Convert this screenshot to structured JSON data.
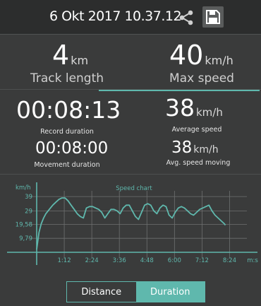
{
  "header": {
    "title": "6 Okt 2017 10.37.12",
    "share_icon": "share-icon",
    "save_icon": "save-icon"
  },
  "stats": {
    "track_length": {
      "value": "4",
      "unit": "km",
      "label": "Track length"
    },
    "max_speed": {
      "value": "40",
      "unit": "km/h",
      "label": "Max speed"
    },
    "record_duration": {
      "value": "00:08:13",
      "label": "Record duration"
    },
    "average_speed": {
      "value": "38",
      "unit": "km/h",
      "label": "Average speed"
    },
    "movement_duration": {
      "value": "00:08:00",
      "label": "Movement duration"
    },
    "avg_speed_moving": {
      "value": "38",
      "unit": "km/h",
      "label": "Avg. speed moving"
    }
  },
  "chart_data": {
    "type": "line",
    "title": "Speed chart",
    "ylabel": "km/h",
    "xlabel": "m:s",
    "y_ticks": [
      "39",
      "29",
      "19,58",
      "9,79"
    ],
    "y_tick_values": [
      39,
      29,
      19.58,
      9.79
    ],
    "x_ticks": [
      "1:12",
      "2:24",
      "3:36",
      "4:48",
      "6:00",
      "7:12",
      "8:24"
    ],
    "x_tick_values": [
      72,
      144,
      216,
      288,
      360,
      432,
      504
    ],
    "xlim": [
      0,
      540
    ],
    "ylim": [
      0,
      44
    ],
    "grid": true,
    "color": "#5fb8ad",
    "series": [
      {
        "x": [
          0,
          6,
          12,
          18,
          24,
          30,
          36,
          42,
          50,
          58,
          66,
          74,
          82,
          90,
          98,
          106,
          114,
          122,
          130,
          138,
          146,
          154,
          162,
          170,
          178,
          186,
          194,
          202,
          210,
          218,
          226,
          234,
          242,
          250,
          258,
          266,
          274,
          282,
          290,
          298,
          306,
          314,
          322,
          330,
          338,
          346,
          354,
          362,
          370,
          378,
          386,
          394,
          402,
          410,
          418,
          426,
          434,
          442,
          450,
          458,
          466,
          474,
          482,
          490,
          493
        ],
        "y": [
          2,
          14,
          20,
          24,
          27,
          29,
          31,
          33,
          35,
          37,
          38,
          38,
          36,
          33,
          30,
          27,
          25,
          24,
          31,
          32,
          32,
          31,
          30,
          28,
          24,
          27,
          30,
          30,
          29,
          27,
          31,
          33,
          33,
          29,
          25,
          23,
          28,
          33,
          34,
          33,
          29,
          27,
          31,
          33,
          32,
          26,
          24,
          28,
          31,
          32,
          31,
          29,
          27,
          26,
          28,
          30,
          31,
          32,
          33,
          29,
          26,
          24,
          22,
          20,
          19
        ]
      }
    ]
  },
  "tabs": [
    {
      "label": "Distance",
      "active": false
    },
    {
      "label": "Duration",
      "active": true
    }
  ]
}
